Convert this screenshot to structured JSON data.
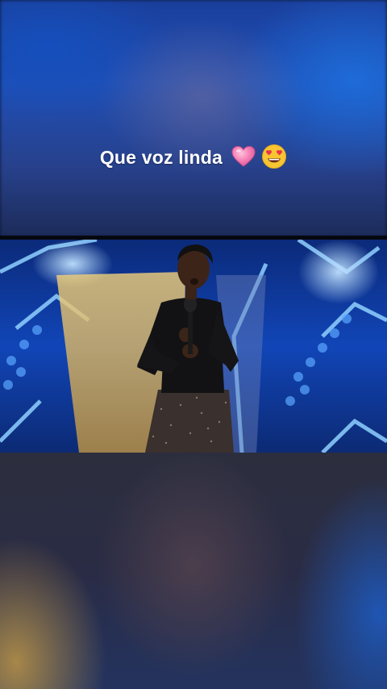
{
  "post": {
    "caption": "Que voz linda",
    "emoji_icons": [
      "pink-heart-icon",
      "heart-eyes-face-icon"
    ]
  },
  "colors": {
    "stage_blue": "#0e3a9e",
    "caption_text": "#ffffff",
    "heart_pink": "#f06aa8",
    "face_yellow": "#f7c531"
  }
}
